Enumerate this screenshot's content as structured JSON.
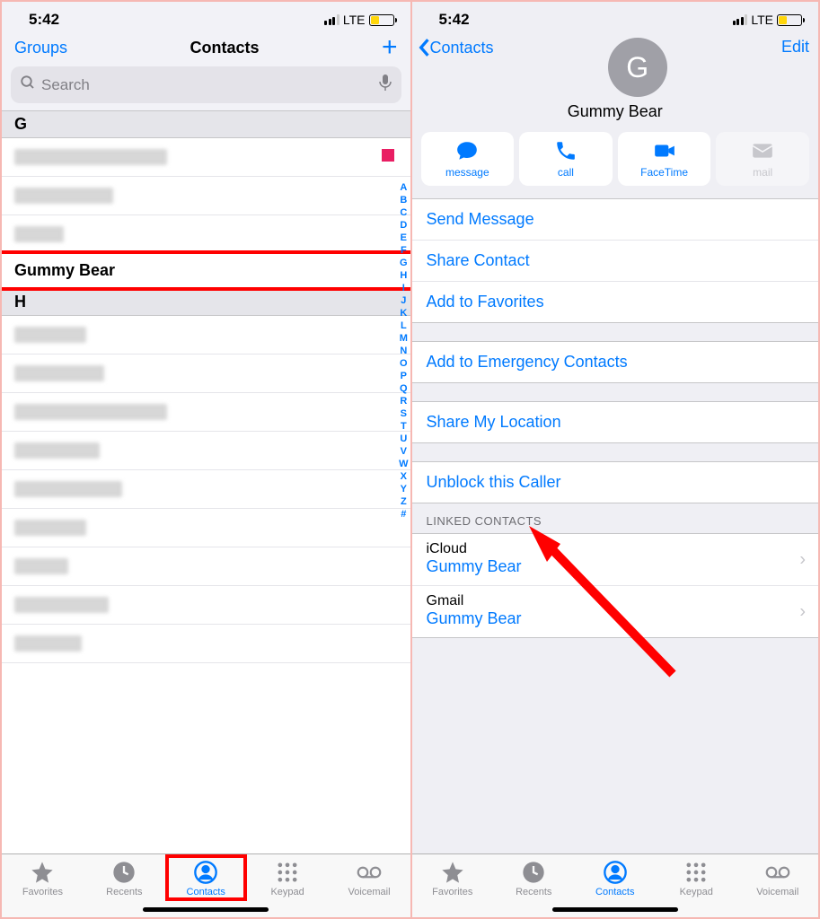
{
  "status": {
    "time": "5:42",
    "carrier": "LTE"
  },
  "left": {
    "nav": {
      "groups": "Groups",
      "title": "Contacts"
    },
    "search_placeholder": "Search",
    "sections": {
      "g": "G",
      "h": "H"
    },
    "highlighted_contact": "Gummy Bear",
    "alpha_index": [
      "A",
      "B",
      "C",
      "D",
      "E",
      "F",
      "G",
      "H",
      "I",
      "J",
      "K",
      "L",
      "M",
      "N",
      "O",
      "P",
      "Q",
      "R",
      "S",
      "T",
      "U",
      "V",
      "W",
      "X",
      "Y",
      "Z",
      "#"
    ]
  },
  "right": {
    "nav": {
      "back": "Contacts",
      "edit": "Edit"
    },
    "avatar_initial": "G",
    "contact_name": "Gummy Bear",
    "actions": {
      "message": "message",
      "call": "call",
      "facetime": "FaceTime",
      "mail": "mail"
    },
    "cells": {
      "send_message": "Send Message",
      "share_contact": "Share Contact",
      "add_favorites": "Add to Favorites",
      "emergency": "Add to Emergency Contacts",
      "share_location": "Share My Location",
      "unblock": "Unblock this Caller"
    },
    "linked_header": "LINKED CONTACTS",
    "linked": [
      {
        "source": "iCloud",
        "name": "Gummy Bear"
      },
      {
        "source": "Gmail",
        "name": "Gummy Bear"
      }
    ]
  },
  "tabs": {
    "favorites": "Favorites",
    "recents": "Recents",
    "contacts": "Contacts",
    "keypad": "Keypad",
    "voicemail": "Voicemail"
  }
}
